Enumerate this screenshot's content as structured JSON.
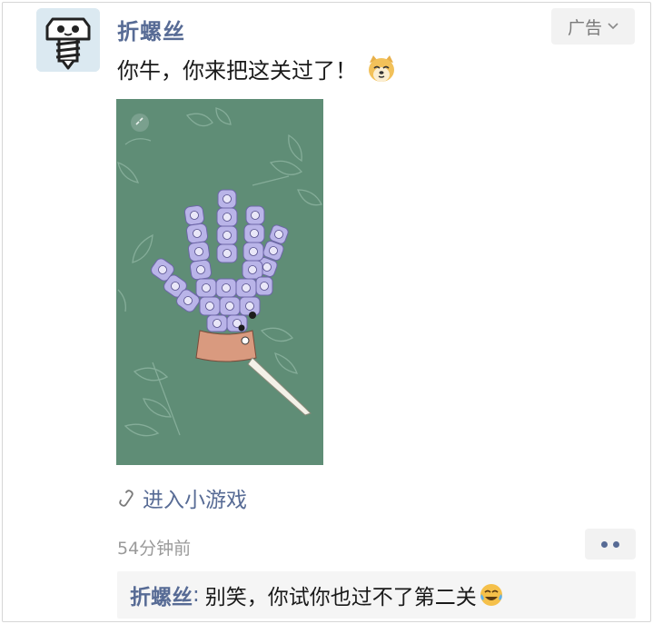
{
  "post": {
    "author": "折螺丝",
    "text": "你牛，你来把这关过了！",
    "ad_label": "广告",
    "mini_program_link": "进入小游戏",
    "time_ago": "54分钟前"
  },
  "comment": {
    "author": "折螺丝",
    "separator": ":",
    "text": "别笑，你试你也过不了第二关"
  },
  "icons": {
    "avatar": "screw-avatar-icon",
    "ad_chevron": "chevron-down-icon",
    "emoji": "doge-emoji-icon",
    "link": "mini-program-link-icon",
    "more": "more-dots-icon",
    "comment_emoji": "laughing-crying-emoji-icon"
  },
  "colors": {
    "link_blue": "#576b95",
    "game_background": "#5f8d76",
    "screw_purple": "#b9b4e8",
    "hand_skin": "#d99a7f"
  }
}
